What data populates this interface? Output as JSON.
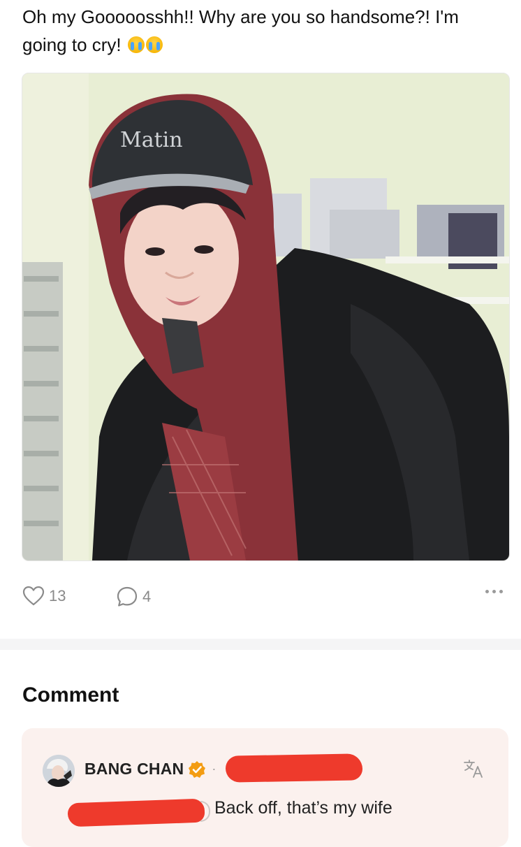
{
  "post": {
    "text": "Oh my Gooooosshh!! Why are you so handsome?! I'm going to cry!",
    "emoji": [
      "loudly-crying-face",
      "loudly-crying-face"
    ],
    "image_hat_text": "Matin"
  },
  "actions": {
    "likes": "13",
    "comments": "4",
    "like_icon": "heart-outline-icon",
    "comment_icon": "speech-bubble-icon",
    "more_icon": "more-horizontal-icon"
  },
  "comments_section": {
    "heading": "Comment",
    "items": [
      {
        "author": "BANG CHAN",
        "verified": true,
        "separator": "·",
        "text": "Back off, that’s my wife",
        "translate_icon": "translate-icon"
      }
    ]
  },
  "colors": {
    "comment_card_bg": "#fbf1ee",
    "verified_badge": "#f39c12",
    "redaction": "#ee3a2c",
    "count_text": "#8a8a8a"
  }
}
